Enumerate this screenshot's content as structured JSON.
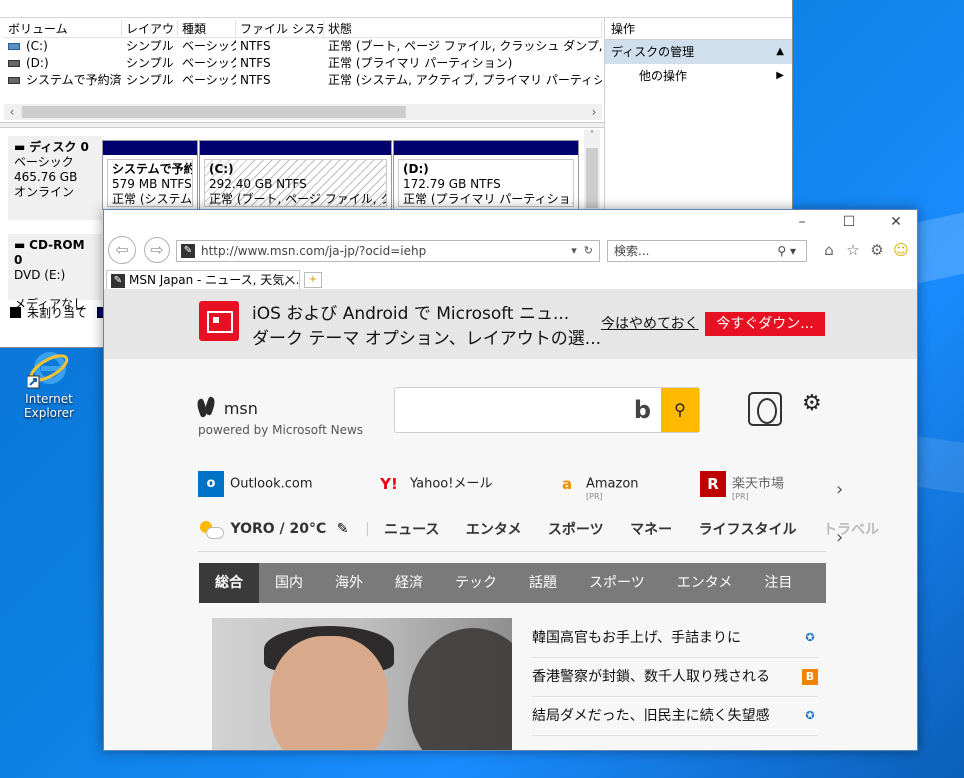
{
  "disk_mgmt": {
    "columns": [
      "ボリューム",
      "レイアウト",
      "種類",
      "ファイル システム",
      "状態"
    ],
    "volumes": [
      {
        "name": "(C:)",
        "layout": "シンプル",
        "type": "ベーシック",
        "fs": "NTFS",
        "status": "正常 (ブート, ページ ファイル, クラッシュ ダンプ, プライマリ パーティ"
      },
      {
        "name": "(D:)",
        "layout": "シンプル",
        "type": "ベーシック",
        "fs": "NTFS",
        "status": "正常 (プライマリ パーティション)"
      },
      {
        "name": "システムで予約済み",
        "layout": "シンプル",
        "type": "ベーシック",
        "fs": "NTFS",
        "status": "正常 (システム, アクティブ, プライマリ パーティション)"
      }
    ],
    "disk0": {
      "title": "ディスク 0",
      "type": "ベーシック",
      "size": "465.76 GB",
      "state": "オンライン"
    },
    "partitions": [
      {
        "name": "システムで予約済",
        "size": "579 MB NTFS",
        "status": "正常 (システム, ア"
      },
      {
        "name": "(C:)",
        "size": "292.40 GB NTFS",
        "status": "正常 (ブート, ページ ファイル, クラッシュ"
      },
      {
        "name": "(D:)",
        "size": "172.79 GB NTFS",
        "status": "正常 (プライマリ パーティション)"
      }
    ],
    "cdrom": {
      "title": "CD-ROM 0",
      "drive": "DVD (E:)",
      "media": "メディアなし"
    },
    "legend": "未割り当て",
    "ops": {
      "header": "操作",
      "selected": "ディスクの管理",
      "other": "他の操作"
    }
  },
  "desktop": {
    "ie_icon_label": "Internet Explorer"
  },
  "ie": {
    "url": "http://www.msn.com/ja-jp/?ocid=iehp",
    "search_placeholder": "検索...",
    "tab_title": "MSN Japan - ニュース, 天気, ...",
    "banner_line1": "iOS および Android で Microsoft ニュ...",
    "banner_line2": "ダーク テーマ オプション、レイアウトの選...",
    "banner_later": "今はやめておく",
    "banner_download": "今すぐダウン...",
    "msn_word": "msn",
    "powered_by": "powered by Microsoft News",
    "quick_links": [
      {
        "label": "Outlook.com",
        "pr": ""
      },
      {
        "label": "Yahoo!メール",
        "pr": ""
      },
      {
        "label": "Amazon",
        "pr": "[PR]"
      },
      {
        "label": "楽天市場",
        "pr": "[PR]"
      }
    ],
    "weather": "YORO / 20°C",
    "categories": [
      "ニュース",
      "エンタメ",
      "スポーツ",
      "マネー",
      "ライフスタイル",
      "トラベル"
    ],
    "news_nav": [
      "総合",
      "国内",
      "海外",
      "経済",
      "テック",
      "話題",
      "スポーツ",
      "エンタメ",
      "注目"
    ],
    "headlines": [
      {
        "text": "韓国高官もお手上げ、手詰まりに",
        "src_color": "#1b74c9"
      },
      {
        "text": "香港警察が封鎖、数千人取り残される",
        "src_color": "#f08300"
      },
      {
        "text": "結局ダメだった、旧民主に続く失望感",
        "src_color": "#1b74c9"
      }
    ]
  }
}
